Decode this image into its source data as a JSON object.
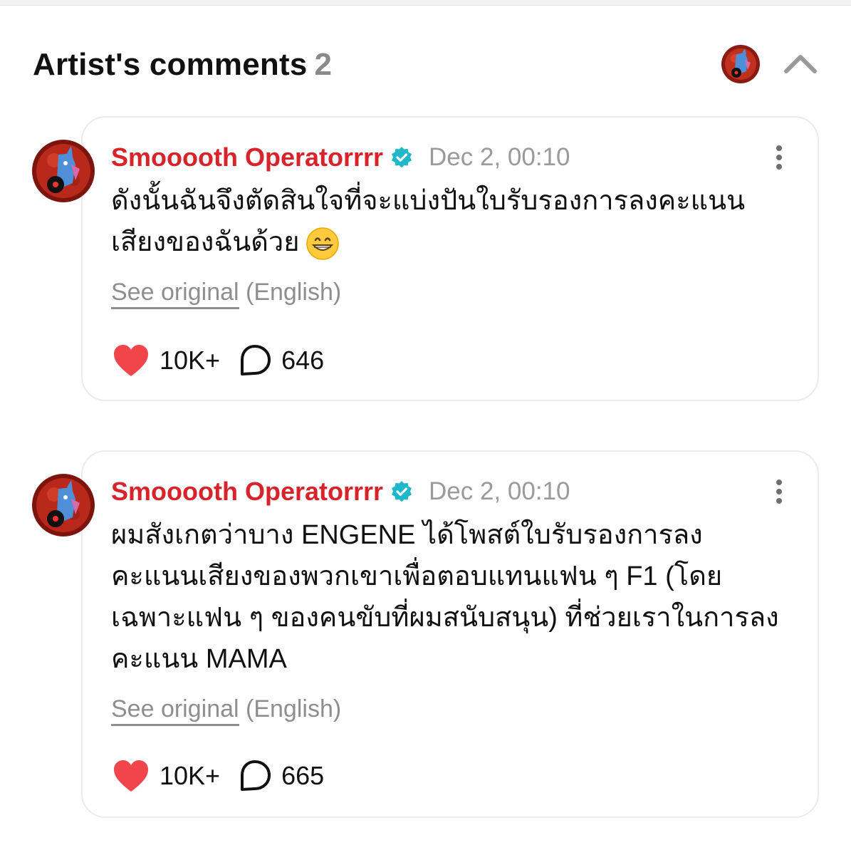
{
  "header": {
    "title": "Artist's comments",
    "count": "2"
  },
  "comments": [
    {
      "author": "Smooooth Operatorrrr",
      "timestamp": "Dec 2, 00:10",
      "text": "ดังนั้นฉันจึงตัดสินใจที่จะแบ่งปันใบรับรองการลงคะแนนเสียงของฉันด้วย",
      "see_original_link": "See original",
      "see_original_lang": "(English)",
      "likes": "10K+",
      "replies": "646"
    },
    {
      "author": "Smooooth Operatorrrr",
      "timestamp": "Dec 2, 00:10",
      "text": "ผมสังเกตว่าบาง ENGENE ได้โพสต์ใบรับรองการลงคะแนนเสียงของพวกเขาเพื่อตอบแทนแฟน ๆ F1 (โดยเฉพาะแฟน ๆ ของคนขับที่ผมสนับสนุน) ที่ช่วยเราในการลงคะแนน MAMA",
      "see_original_link": "See original",
      "see_original_lang": "(English)",
      "likes": "10K+",
      "replies": "665"
    }
  ],
  "colors": {
    "author": "#d8232a",
    "verified": "#1fb7c9",
    "heart": "#f0454a",
    "muted": "#8e8e8e"
  },
  "icons": {
    "header_avatar": "artist-avatar-icon",
    "collapse": "chevron-up-icon",
    "verified": "verified-badge-icon",
    "more": "more-vertical-icon",
    "like": "heart-icon",
    "reply": "speech-bubble-icon",
    "emoji": "grinning-face-emoji"
  }
}
